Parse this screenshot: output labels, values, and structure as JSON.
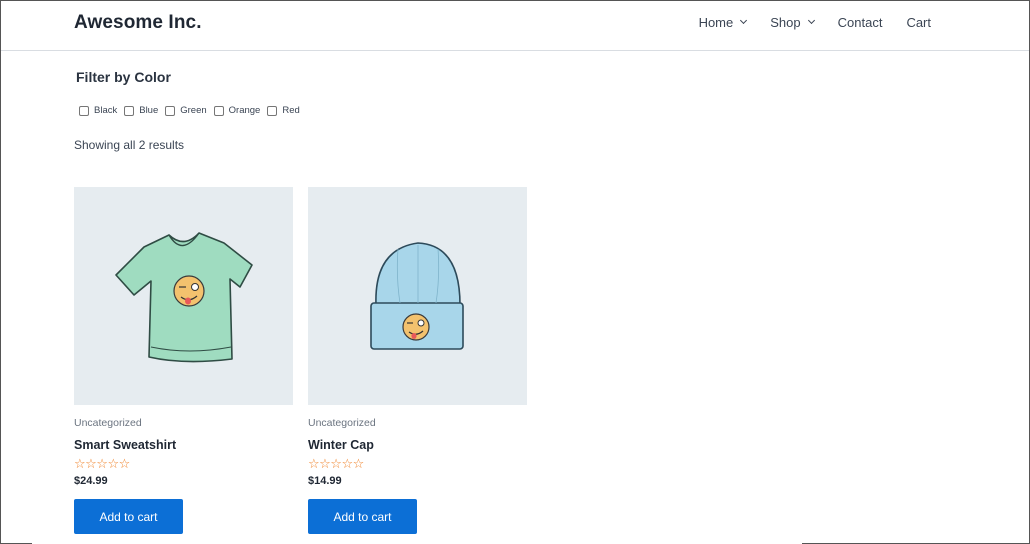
{
  "site": {
    "title": "Awesome Inc."
  },
  "nav": {
    "items": [
      {
        "label": "Home",
        "has_dropdown": true
      },
      {
        "label": "Shop",
        "has_dropdown": true
      },
      {
        "label": "Contact",
        "has_dropdown": false
      },
      {
        "label": "Cart",
        "has_dropdown": false
      }
    ]
  },
  "filter": {
    "title": "Filter by Color",
    "options": [
      {
        "label": "Black",
        "checked": false
      },
      {
        "label": "Blue",
        "checked": false
      },
      {
        "label": "Green",
        "checked": false
      },
      {
        "label": "Orange",
        "checked": false
      },
      {
        "label": "Red",
        "checked": false
      }
    ]
  },
  "results": {
    "text": "Showing all 2 results"
  },
  "products": [
    {
      "category": "Uncategorized",
      "name": "Smart Sweatshirt",
      "rating_stars": "☆☆☆☆☆",
      "price": "$24.99",
      "button_label": "Add to cart",
      "image_icon": "green-tshirt-winking-emoji"
    },
    {
      "category": "Uncategorized",
      "name": "Winter Cap",
      "rating_stars": "☆☆☆☆☆",
      "price": "$14.99",
      "button_label": "Add to cart",
      "image_icon": "blue-beanie-winking-emoji"
    }
  ],
  "colors": {
    "accent": "#0c6fd6",
    "star": "#f0842c",
    "thumb_bg": "#e6ecf0"
  }
}
